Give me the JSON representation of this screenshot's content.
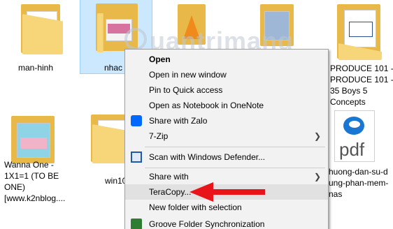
{
  "files": [
    {
      "label": "man-hinh"
    },
    {
      "label": "nhac"
    },
    {
      "label": "PRODUCE 101 -\nPRODUCE 101 -\n35 Boys 5\nConcepts"
    },
    {
      "label": "Wanna One -\n1X1=1 (TO BE\nONE)\n[www.k2nblog...."
    },
    {
      "label": "win10"
    },
    {
      "label": "huong-dan-su-d\nung-phan-mem-\nnas"
    }
  ],
  "pdf_icon_text": "pdf",
  "watermark": "uantrimang",
  "menu": {
    "items": [
      {
        "label": "Open",
        "bold": true
      },
      {
        "label": "Open in new window"
      },
      {
        "label": "Pin to Quick access"
      },
      {
        "label": "Open as Notebook in OneNote"
      },
      {
        "label": "Share with Zalo",
        "icon": "zalo-icon"
      },
      {
        "label": "7-Zip",
        "submenu": true
      },
      {
        "label": "Scan with Windows Defender...",
        "icon": "windows-defender-icon"
      },
      {
        "label": "Share with",
        "submenu": true
      },
      {
        "label": "TeraCopy...",
        "highlighted": true
      },
      {
        "label": "New folder with selection"
      },
      {
        "label": "Groove Folder Synchronization",
        "icon": "groove-icon"
      }
    ]
  },
  "annotation": {
    "arrow_color": "#e8141a"
  },
  "colors": {
    "selection": "#cce8ff",
    "folder": "#e8b949",
    "zalo": "#0068ff"
  }
}
